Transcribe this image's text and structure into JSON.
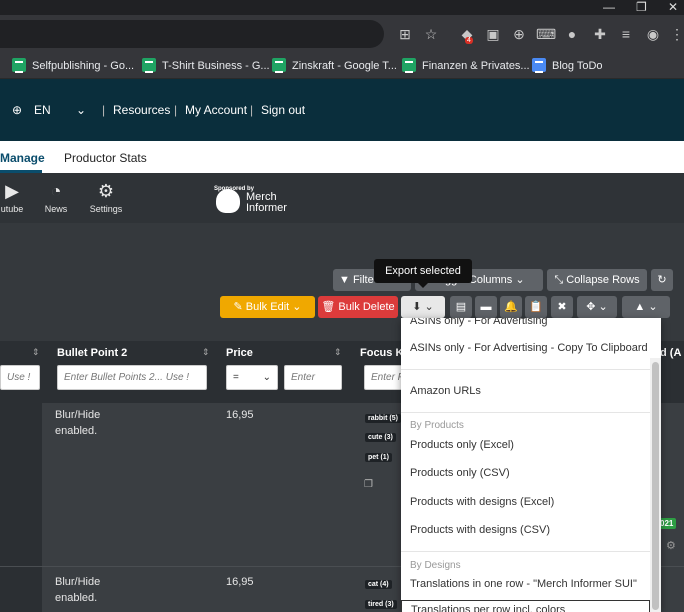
{
  "browser": {
    "bookmarks": [
      {
        "label": "Selfpublishing - Go...",
        "icon": "google-sheets-icon"
      },
      {
        "label": "T-Shirt Business - G...",
        "icon": "google-sheets-icon"
      },
      {
        "label": "Zinskraft - Google T...",
        "icon": "google-sheets-icon"
      },
      {
        "label": "Finanzen & Privates...",
        "icon": "google-sheets-icon"
      },
      {
        "label": "Blog ToDo",
        "icon": "google-docs-icon"
      }
    ],
    "extension_badge": "4"
  },
  "site_nav": {
    "language": "EN",
    "links": [
      "Resources",
      "My Account",
      "Sign out"
    ],
    "separator": "|"
  },
  "tabs": [
    "Manage",
    "Productor Stats"
  ],
  "toolbar": {
    "items": [
      {
        "label": "utube",
        "icon": "youtube-icon"
      },
      {
        "label": "News",
        "icon": "rss-icon"
      },
      {
        "label": "Settings",
        "icon": "gears-icon"
      }
    ],
    "sponsor_label": "Sponsored by",
    "sponsor_name_1": "Merch",
    "sponsor_name_2": "Informer"
  },
  "actions": {
    "filter": "Filte",
    "toggle_columns": "Toggle Columns",
    "collapse_rows": "Collapse Rows",
    "bulk_edit": "Bulk Edit",
    "bulk_delete": "Bulk Delete",
    "tooltip": "Export selected"
  },
  "table": {
    "headers": [
      "Bullet Point 2",
      "Price",
      "Focus Ke",
      "d (A"
    ],
    "filters": {
      "col0": "Use !",
      "bullet2": "Enter Bullet Points 2... Use !",
      "price_op": "=",
      "price_value": "Enter",
      "focus": "Enter F"
    },
    "rows": [
      {
        "bullet2": [
          "Blur/Hide",
          "enabled."
        ],
        "price": "16,95",
        "keywords": [
          "rabbit (5)",
          "cute (3)",
          "pet (1)"
        ]
      },
      {
        "bullet2": [
          "Blur/Hide",
          "enabled."
        ],
        "price": "16,95",
        "keywords": [
          "cat (4)",
          "tired (3)"
        ]
      }
    ],
    "badge": "021"
  },
  "export_menu": {
    "items_top": [
      "ASINs only - For Advertising",
      "ASINs only - For Advertising - Copy To Clipboard",
      "Amazon URLs"
    ],
    "group_products": "By Products",
    "items_products": [
      "Products only (Excel)",
      "Products only (CSV)",
      "Products with designs (Excel)",
      "Products with designs (CSV)"
    ],
    "group_designs": "By Designs",
    "items_designs": [
      "Translations in one row - \"Merch Informer SUI\"",
      "Translations per row incl. colors"
    ]
  }
}
